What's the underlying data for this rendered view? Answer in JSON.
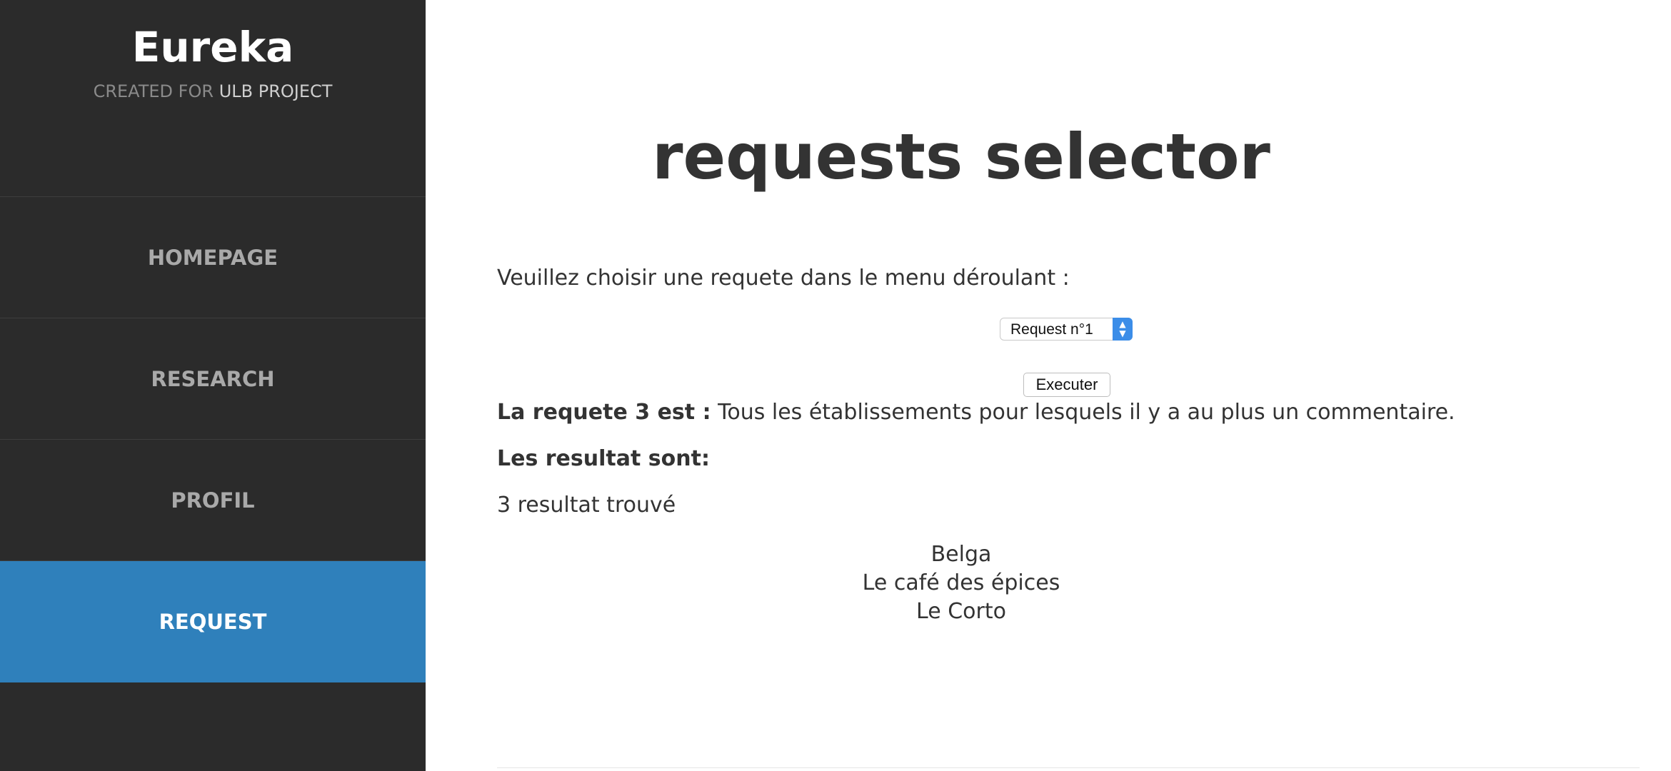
{
  "sidebar": {
    "brand_title": "Eureka",
    "brand_sub_prefix": "CREATED FOR",
    "brand_sub_highlight": "ULB PROJECT",
    "items": [
      {
        "label": "HOMEPAGE"
      },
      {
        "label": "RESEARCH"
      },
      {
        "label": "PROFIL"
      },
      {
        "label": "REQUEST"
      }
    ],
    "active_item": "REQUEST",
    "active_color": "#2f80bb"
  },
  "main": {
    "title": "requests selector",
    "prompt": "Veuillez choisir une requete dans le menu déroulant :",
    "select": {
      "selected": "Request n°1"
    },
    "execute_label": "Executer",
    "query_prefix": "La requete 3 est :",
    "query_text": "Tous les établissements pour lesquels il y a au plus un commentaire.",
    "results_heading": "Les resultat sont:",
    "results_count": "3 resultat trouvé",
    "results": [
      "Belga",
      "Le café des épices",
      "Le Corto"
    ]
  }
}
